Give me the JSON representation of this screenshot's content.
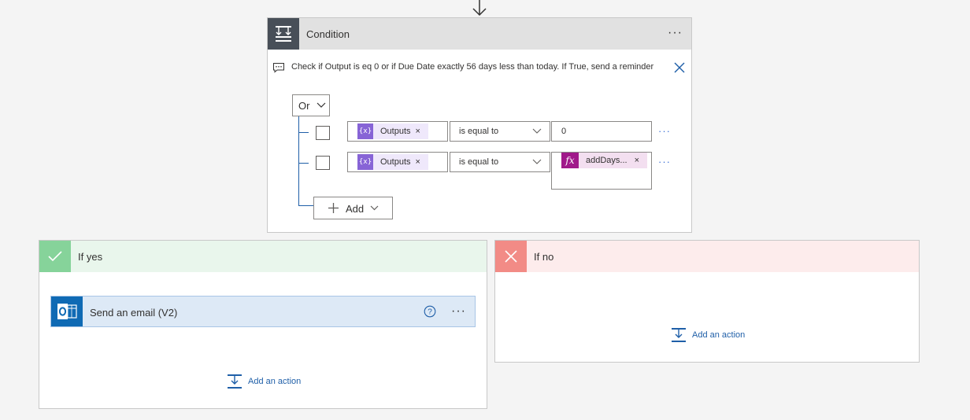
{
  "condition": {
    "title": "Condition",
    "menu_label": "···",
    "comment": "Check if Output is eq 0 or if Due Date exactly 56 days less than today. If True, send a reminder",
    "group_operator": "Or",
    "rows": [
      {
        "token_icon": "{x}",
        "token_label": "Outputs",
        "remove": "×",
        "operator": "is equal to",
        "value": "0",
        "more": "···"
      },
      {
        "token_icon": "{x}",
        "token_label": "Outputs",
        "remove": "×",
        "operator": "is equal to",
        "value_expression": "addDays...",
        "value_icon": "fx",
        "more": "···"
      }
    ],
    "add_button": "Add"
  },
  "branches": {
    "yes": {
      "title": "If yes",
      "color": "#86d39a",
      "header_bg": "#e9f6ec",
      "action": {
        "title": "Send an email (V2)",
        "help": "?",
        "menu": "···"
      },
      "add_action": "Add an action"
    },
    "no": {
      "title": "If no",
      "color": "#f28b86",
      "header_bg": "#fdecec",
      "add_action": "Add an action"
    }
  },
  "icons": {
    "top": "arrow-down-icon",
    "condition": "condition-icon",
    "comment": "comment-icon",
    "close": "close-icon",
    "check": "check-icon",
    "cross": "cross-icon",
    "outlook": "outlook-icon",
    "help": "help-icon",
    "add_action": "add-action-icon"
  }
}
